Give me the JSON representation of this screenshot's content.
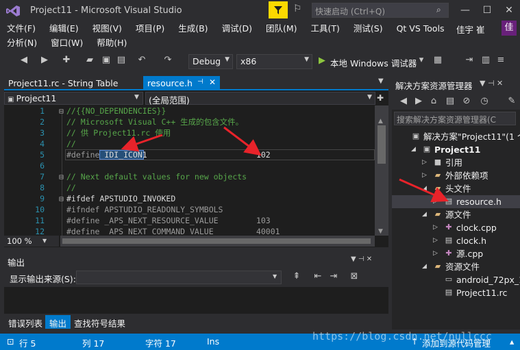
{
  "window": {
    "title": "Project11 - Microsoft Visual Studio",
    "quick_launch_placeholder": "快速启动 (Ctrl+Q)",
    "user_name": "佳宇 崔",
    "user_initial": "佳"
  },
  "menu": {
    "row1": [
      "文件(F)",
      "编辑(E)",
      "视图(V)",
      "项目(P)",
      "生成(B)",
      "调试(D)",
      "团队(M)",
      "工具(T)",
      "测试(S)",
      "Qt VS Tools"
    ],
    "row2": [
      "分析(N)",
      "窗口(W)",
      "帮助(H)"
    ]
  },
  "toolbar": {
    "config": "Debug",
    "platform": "x86",
    "run_label": "本地 Windows 调试器"
  },
  "editor": {
    "tabs": [
      {
        "label": "Project11.rc - String Table",
        "active": false
      },
      {
        "label": "resource.h",
        "active": true
      }
    ],
    "nav_left": "Project11",
    "nav_right": "(全局范围)",
    "zoom": "100 %",
    "lines": [
      {
        "n": "1",
        "fold": "⊟",
        "segments": [
          {
            "t": "//{{NO_DEPENDENCIES}}",
            "c": "c-comment"
          }
        ]
      },
      {
        "n": "2",
        "fold": "",
        "segments": [
          {
            "t": "// Microsoft Visual C++ 生成的包含文件。",
            "c": "c-comment"
          }
        ]
      },
      {
        "n": "3",
        "fold": "",
        "segments": [
          {
            "t": "// 供 Project11.rc 使用",
            "c": "c-comment"
          }
        ]
      },
      {
        "n": "4",
        "fold": "",
        "segments": [
          {
            "t": "//",
            "c": "c-comment"
          }
        ]
      },
      {
        "n": "5",
        "fold": "",
        "segments": [
          {
            "t": "#define ",
            "c": "c-pre"
          },
          {
            "t": "IDI_ICON1",
            "c": "c-plain"
          },
          {
            "t": "                       ",
            "c": "c-plain"
          },
          {
            "t": "102",
            "c": "c-plain"
          }
        ]
      },
      {
        "n": "6",
        "fold": "",
        "segments": []
      },
      {
        "n": "7",
        "fold": "⊟",
        "segments": [
          {
            "t": "// Next default values for new objects",
            "c": "c-comment"
          }
        ]
      },
      {
        "n": "8",
        "fold": "",
        "segments": [
          {
            "t": "//",
            "c": "c-comment"
          }
        ]
      },
      {
        "n": "9",
        "fold": "⊟",
        "segments": [
          {
            "t": "#ifdef APSTUDIO_INVOKED",
            "c": "c-plain"
          }
        ]
      },
      {
        "n": "10",
        "fold": "",
        "segments": [
          {
            "t": "#ifndef APSTUDIO_READONLY_SYMBOLS",
            "c": "c-pre"
          }
        ]
      },
      {
        "n": "11",
        "fold": "",
        "segments": [
          {
            "t": "#define _APS_NEXT_RESOURCE_VALUE        ",
            "c": "c-pre"
          },
          {
            "t": "103",
            "c": "c-pre"
          }
        ]
      },
      {
        "n": "12",
        "fold": "",
        "segments": [
          {
            "t": "#define _APS_NEXT_COMMAND_VALUE         ",
            "c": "c-pre"
          },
          {
            "t": "40001",
            "c": "c-pre"
          }
        ]
      }
    ]
  },
  "output": {
    "title": "输出",
    "source_label": "显示输出来源(S):",
    "source_value": ""
  },
  "bottom_tabs": [
    "错误列表",
    "输出",
    "查找符号结果"
  ],
  "solution_explorer": {
    "title": "解决方案资源管理器",
    "search_placeholder": "搜索解决方案资源管理器(C",
    "items": [
      {
        "label": "解决方案\"Project11\"(1 个项",
        "indent": 0,
        "arrow": "",
        "icon": "solution-icon",
        "bold": false
      },
      {
        "label": "Project11",
        "indent": 1,
        "arrow": "◢",
        "icon": "project-icon",
        "bold": true
      },
      {
        "label": "引用",
        "indent": 2,
        "arrow": "▷",
        "icon": "references-icon",
        "bold": false
      },
      {
        "label": "外部依赖项",
        "indent": 2,
        "arrow": "▷",
        "icon": "external-deps-icon",
        "bold": false
      },
      {
        "label": "头文件",
        "indent": 2,
        "arrow": "◢",
        "icon": "folder-icon",
        "bold": false
      },
      {
        "label": "resource.h",
        "indent": 3,
        "arrow": "▷",
        "icon": "header-file-icon",
        "bold": false,
        "selected": true
      },
      {
        "label": "源文件",
        "indent": 2,
        "arrow": "◢",
        "icon": "folder-icon",
        "bold": false
      },
      {
        "label": "clock.cpp",
        "indent": 3,
        "arrow": "▷",
        "icon": "cpp-file-icon",
        "bold": false
      },
      {
        "label": "clock.h",
        "indent": 3,
        "arrow": "▷",
        "icon": "header-file-icon",
        "bold": false
      },
      {
        "label": "源.cpp",
        "indent": 3,
        "arrow": "▷",
        "icon": "cpp-file-icon",
        "bold": false
      },
      {
        "label": "资源文件",
        "indent": 2,
        "arrow": "◢",
        "icon": "folder-icon",
        "bold": false
      },
      {
        "label": "android_72px_1",
        "indent": 3,
        "arrow": "",
        "icon": "image-file-icon",
        "bold": false
      },
      {
        "label": "Project11.rc",
        "indent": 3,
        "arrow": "",
        "icon": "rc-file-icon",
        "bold": false
      }
    ]
  },
  "statusbar": {
    "ready": "行 5",
    "col": "列 17",
    "char": "字符 17",
    "mode": "Ins",
    "source_control": "添加到源代码管理"
  },
  "watermark": "https://blog.csdn.net/nullccc",
  "colors": {
    "accent": "#007acc",
    "arrow": "#e8232a",
    "filter": "#fcd900"
  }
}
